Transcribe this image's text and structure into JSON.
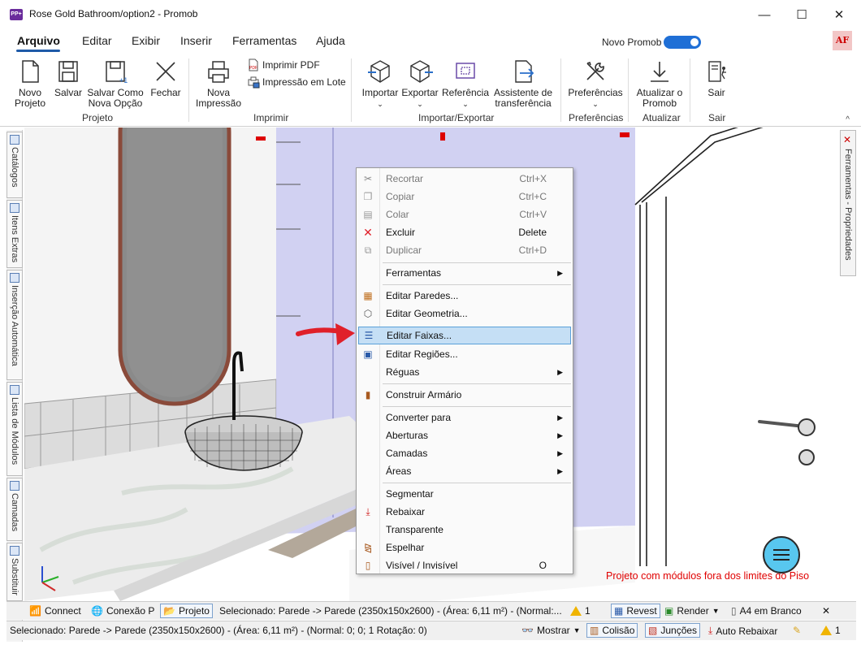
{
  "window": {
    "title": "Rose Gold Bathroom/option2 - Promob",
    "logo_text": "PP+",
    "minimize": "—",
    "maximize": "☐",
    "close": "✕"
  },
  "menu": {
    "items": [
      "Arquivo",
      "Editar",
      "Exibir",
      "Inserir",
      "Ferramentas",
      "Ajuda"
    ],
    "active": "Arquivo",
    "novo_promob": "Novo Promob",
    "avatar": "AF"
  },
  "ribbon": {
    "projeto": {
      "buttons": [
        "Novo\nProjeto",
        "Salvar",
        "Salvar Como\nNova Opção",
        "Fechar"
      ],
      "novo_l1": "Novo",
      "novo_l2": "Projeto",
      "salvar": "Salvar",
      "salvar_como_l1": "Salvar Como",
      "salvar_como_l2": "Nova Opção",
      "fechar": "Fechar",
      "label": "Projeto"
    },
    "imprimir": {
      "nova_l1": "Nova",
      "nova_l2": "Impressão",
      "pdf": "Imprimir PDF",
      "lote": "Impressão em Lote",
      "label": "Imprimir"
    },
    "importar_exportar": {
      "importar": "Importar",
      "exportar": "Exportar",
      "referencia": "Referência",
      "assistente_l1": "Assistente de",
      "assistente_l2": "transferência",
      "label": "Importar/Exportar"
    },
    "preferencias": {
      "button": "Preferências",
      "label": "Preferências"
    },
    "atualizar": {
      "l1": "Atualizar o",
      "l2": "Promob",
      "label": "Atualizar"
    },
    "sair": {
      "button": "Sair",
      "label": "Sair"
    },
    "collapse": "^"
  },
  "left_tabs": [
    "Catálogos",
    "Itens Extras",
    "Inserção Automática",
    "Lista de Módulos",
    "Camadas",
    "Substituir"
  ],
  "right_tab": "Ferramentas - Propriedades",
  "viewport": {
    "warning": "Projeto com módulos fora dos limites do Piso",
    "ruler_marks": [
      "0",
      "0",
      "0",
      "0"
    ]
  },
  "context_menu": {
    "items": [
      {
        "label": "Recortar",
        "shortcut": "Ctrl+X",
        "disabled": true,
        "icon": "scissors-icon"
      },
      {
        "label": "Copiar",
        "shortcut": "Ctrl+C",
        "disabled": true,
        "icon": "copy-icon"
      },
      {
        "label": "Colar",
        "shortcut": "Ctrl+V",
        "disabled": true,
        "icon": "paste-icon"
      },
      {
        "label": "Excluir",
        "shortcut": "Delete",
        "disabled": false,
        "icon": "delete-icon"
      },
      {
        "label": "Duplicar",
        "shortcut": "Ctrl+D",
        "disabled": true,
        "icon": "duplicate-icon"
      },
      {
        "label": "Ferramentas",
        "submenu": true
      },
      {
        "label": "Editar Paredes...",
        "icon": "walls-icon"
      },
      {
        "label": "Editar Geometria...",
        "icon": "geometry-icon"
      },
      {
        "label": "Editar Faixas...",
        "icon": "stripes-icon",
        "highlighted": true
      },
      {
        "label": "Editar Regiões...",
        "icon": "regions-icon"
      },
      {
        "label": "Réguas",
        "submenu": true
      },
      {
        "label": "Construir Armário",
        "icon": "cabinet-icon"
      },
      {
        "label": "Converter para",
        "submenu": true
      },
      {
        "label": "Aberturas",
        "submenu": true
      },
      {
        "label": "Camadas",
        "submenu": true
      },
      {
        "label": "Áreas",
        "submenu": true
      },
      {
        "label": "Segmentar"
      },
      {
        "label": "Rebaixar",
        "icon": "lower-icon"
      },
      {
        "label": "Transparente"
      },
      {
        "label": "Espelhar",
        "icon": "mirror-icon"
      },
      {
        "label": "Visível / Invisível",
        "shortcut": "O",
        "icon": "visibility-icon"
      }
    ]
  },
  "status_bar_1": {
    "connect": "Connect",
    "conexao": "Conexão P",
    "projeto": "Projeto",
    "selecionado": "Selecionado: Parede -> Parede (2350x150x2600) - (Área: 6,11 m²) - (Normal:...",
    "alerts": "1",
    "revest": "Revest",
    "render": "Render",
    "a4": "A4 em Branco",
    "close": "✕"
  },
  "status_bar_2": {
    "selecionado": "Selecionado: Parede -> Parede (2350x150x2600) - (Área: 6,11 m²) - (Normal: 0; 0; 1 Rotação: 0)",
    "mostrar": "Mostrar",
    "colisao": "Colisão",
    "juncoes": "Junções",
    "auto_rebaixar": "Auto Rebaixar",
    "alerts": "1"
  }
}
